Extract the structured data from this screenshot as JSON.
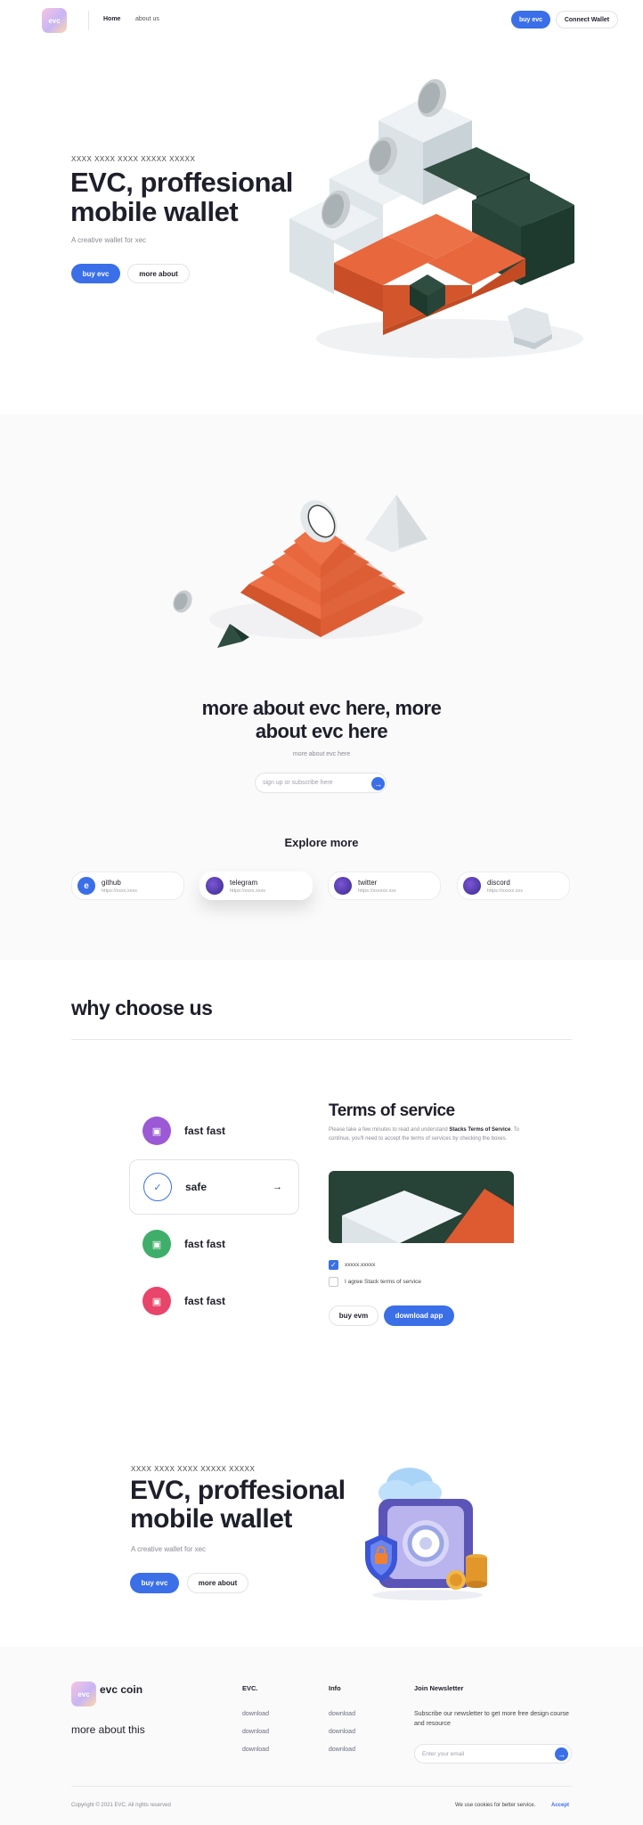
{
  "header": {
    "logo_text": "evc",
    "nav": [
      "Home",
      "about us"
    ],
    "buy_label": "buy evc",
    "connect_label": "Connect Wallet"
  },
  "hero": {
    "eyebrow": "XXXX XXXX XXXX XXXXX XXXXX",
    "title_line1": "EVC, proffesional",
    "title_line2": "mobile wallet",
    "subtitle": "A creative wallet for xec",
    "buy_label": "buy evc",
    "more_label": "more about"
  },
  "about": {
    "title_line1": "more about evc here, more",
    "title_line2": "about evc here",
    "subtitle": "more about evc here",
    "input_placeholder": "sign up or subscribe here"
  },
  "explore": {
    "title": "Explore more",
    "cards": [
      {
        "name": "github",
        "url": "https://xxxx.xxxx"
      },
      {
        "name": "telegram",
        "url": "https://xxxx.xxxx"
      },
      {
        "name": "twitter",
        "url": "https://xxxxxx.xxx"
      },
      {
        "name": "discord",
        "url": "https://xxxxx.xxx"
      }
    ]
  },
  "why": {
    "title": "why choose us",
    "features": [
      {
        "label": "fast fast",
        "color": "#9b59d6"
      },
      {
        "label": "safe",
        "color": "#3b6fe8"
      },
      {
        "label": "fast fast",
        "color": "#3fae6a"
      },
      {
        "label": "fast fast",
        "color": "#e8456a"
      }
    ],
    "arrow": "→"
  },
  "terms": {
    "title": "Terms of service",
    "text_a": "Please take a few minutes to read and understand ",
    "text_b": "Stacks Terms of Service",
    "text_c": ". To continue, you'll need to accept the terms of services by checking the boxes.",
    "check1_label": "xxxxx.xxxxx",
    "check2_label": "I agree Stack terms of service",
    "buy_label": "buy evm",
    "download_label": "download app"
  },
  "hero2": {
    "eyebrow": "XXXX XXXX XXXX XXXXX XXXXX",
    "title_line1": "EVC, proffesional",
    "title_line2": "mobile wallet",
    "subtitle": "A creative wallet for xec",
    "buy_label": "buy evc",
    "more_label": "more about"
  },
  "footer": {
    "logo_text": "evc",
    "brand": "evc coin",
    "tagline": "more about this",
    "col1_title": "EVC.",
    "col1_links": [
      "download",
      "download",
      "download"
    ],
    "col2_title": "Info",
    "col2_links": [
      "download",
      "download",
      "download"
    ],
    "newsletter_title": "Join Newsletter",
    "newsletter_text": "Subscribe our newsletter to get more free design course and resource",
    "email_placeholder": "Enter your email",
    "copyright": "Copyright © 2021 EVC. All rights reserved",
    "cookie_text": "We use cookies for better service.",
    "accept_label": "Accept"
  },
  "colors": {
    "accent": "#3b6fe8",
    "orange": "#de5a31",
    "dark_green": "#274236",
    "light_block": "#dde4e8"
  }
}
